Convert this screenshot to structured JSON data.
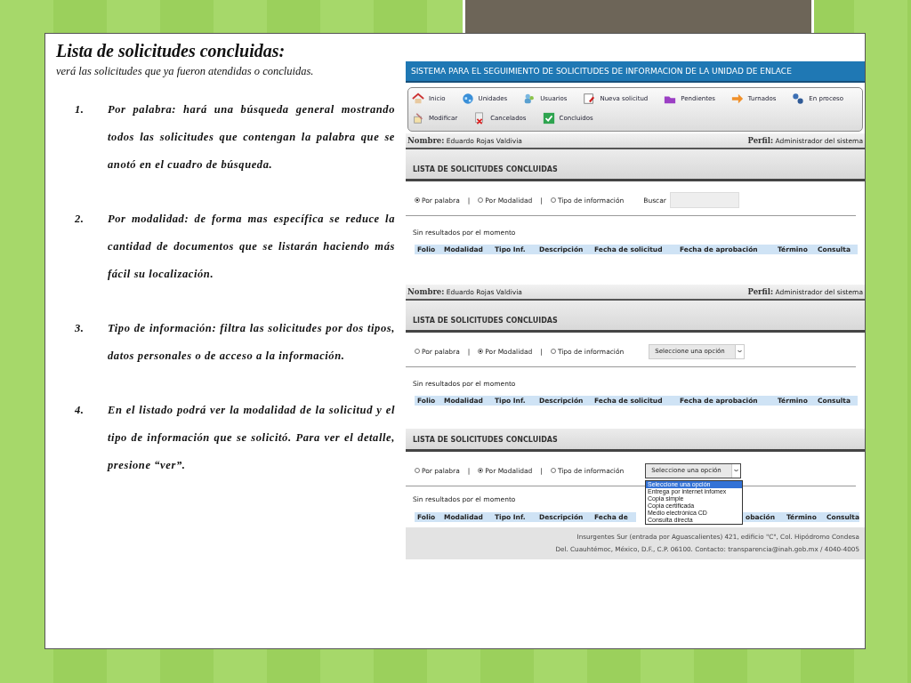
{
  "slide": {
    "title": "Lista de solicitudes concluidas:",
    "subtitle": "verá las solicitudes que ya fueron atendidas o concluidas.",
    "items": [
      {
        "number": "1.",
        "text": "Por palabra: hará una búsqueda general mostrando todos las solicitudes que contengan la palabra que se anotó en el cuadro de búsqueda."
      },
      {
        "number": "2.",
        "text": "Por modalidad: de forma mas específica se reduce la cantidad de documentos que se listarán haciendo más fácil su localización."
      },
      {
        "number": "3.",
        "text": "Tipo de información: filtra las solicitudes por dos tipos, datos personales o de acceso a la información."
      },
      {
        "number": "4.",
        "text": "En el listado podrá ver la modalidad de la solicitud y el tipo de información que se solicitó. Para ver el detalle, presione “ver”."
      }
    ]
  },
  "screens": [
    {
      "app_title": "SISTEMA PARA EL SEGUIMIENTO DE SOLICITUDES DE INFORMACION DE LA UNIDAD DE ENLACE",
      "nav": [
        {
          "label": "Inicio"
        },
        {
          "label": "Unidades"
        },
        {
          "label": "Usuarios"
        },
        {
          "label": "Nueva solicitud"
        },
        {
          "label": "Pendientes"
        },
        {
          "label": "Turnados"
        },
        {
          "label": "En proceso"
        },
        {
          "label": "Modificar"
        },
        {
          "label": "Cancelados"
        },
        {
          "label": "Concluidos"
        }
      ],
      "user": {
        "name_label": "Nombre:",
        "name": "Eduardo Rojas Valdivia",
        "profile_label": "Perfil:",
        "profile": "Administrador del sistema"
      },
      "list_title": "LISTA DE SOLICITUDES CONCLUIDAS",
      "filters": [
        {
          "label": "Por palabra",
          "selected": true
        },
        {
          "label": "Por Modalidad",
          "selected": false
        },
        {
          "label": "Tipo de información",
          "selected": false
        }
      ],
      "separator": "|",
      "search": {
        "label": "Buscar"
      },
      "status": "Sin resultados por el momento",
      "columns": [
        "Folio",
        "Modalidad",
        "Tipo Inf.",
        "Descripción",
        "Fecha de solicitud",
        "Fecha de aprobación",
        "Término",
        "Consulta"
      ]
    },
    {
      "user": {
        "name_label": "Nombre:",
        "name": "Eduardo Rojas Valdivia",
        "profile_label": "Perfil:",
        "profile": "Administrador del sistema"
      },
      "list_title": "LISTA DE SOLICITUDES CONCLUIDAS",
      "filters": [
        {
          "label": "Por palabra",
          "selected": false
        },
        {
          "label": "Por Modalidad",
          "selected": true
        },
        {
          "label": "Tipo de información",
          "selected": false
        }
      ],
      "separator": "|",
      "select": {
        "value": "Seleccione una opción",
        "open": false
      },
      "status": "Sin resultados por el momento",
      "columns": [
        "Folio",
        "Modalidad",
        "Tipo Inf.",
        "Descripción",
        "Fecha de solicitud",
        "Fecha de aprobación",
        "Término",
        "Consulta"
      ]
    },
    {
      "list_title": "LISTA DE SOLICITUDES CONCLUIDAS",
      "filters": [
        {
          "label": "Por palabra",
          "selected": false
        },
        {
          "label": "Por Modalidad",
          "selected": true
        },
        {
          "label": "Tipo de información",
          "selected": false
        }
      ],
      "separator": "|",
      "select": {
        "value": "Seleccione una opción",
        "open": true,
        "options": [
          {
            "label": "Seleccione una opción",
            "selected": true
          },
          {
            "label": "Entrega por internet infomex",
            "selected": false
          },
          {
            "label": "Copia simple",
            "selected": false
          },
          {
            "label": "Copia certificada",
            "selected": false
          },
          {
            "label": "Medio electrónica CD",
            "selected": false
          },
          {
            "label": "Consulta directa",
            "selected": false
          }
        ]
      },
      "status": "Sin resultados por el momento",
      "columns": [
        "Folio",
        "Modalidad",
        "Tipo Inf.",
        "Descripción",
        "Fecha de",
        "obación",
        "Término",
        "Consulta"
      ],
      "footer": [
        "Insurgentes Sur (entrada por Aguascalientes) 421, edificio \"C\", Col. Hipódromo Condesa",
        "Del. Cuauhtémoc, México, D.F., C.P. 06100. Contacto: transparencia@inah.gob.mx / 4040-4005"
      ]
    }
  ]
}
